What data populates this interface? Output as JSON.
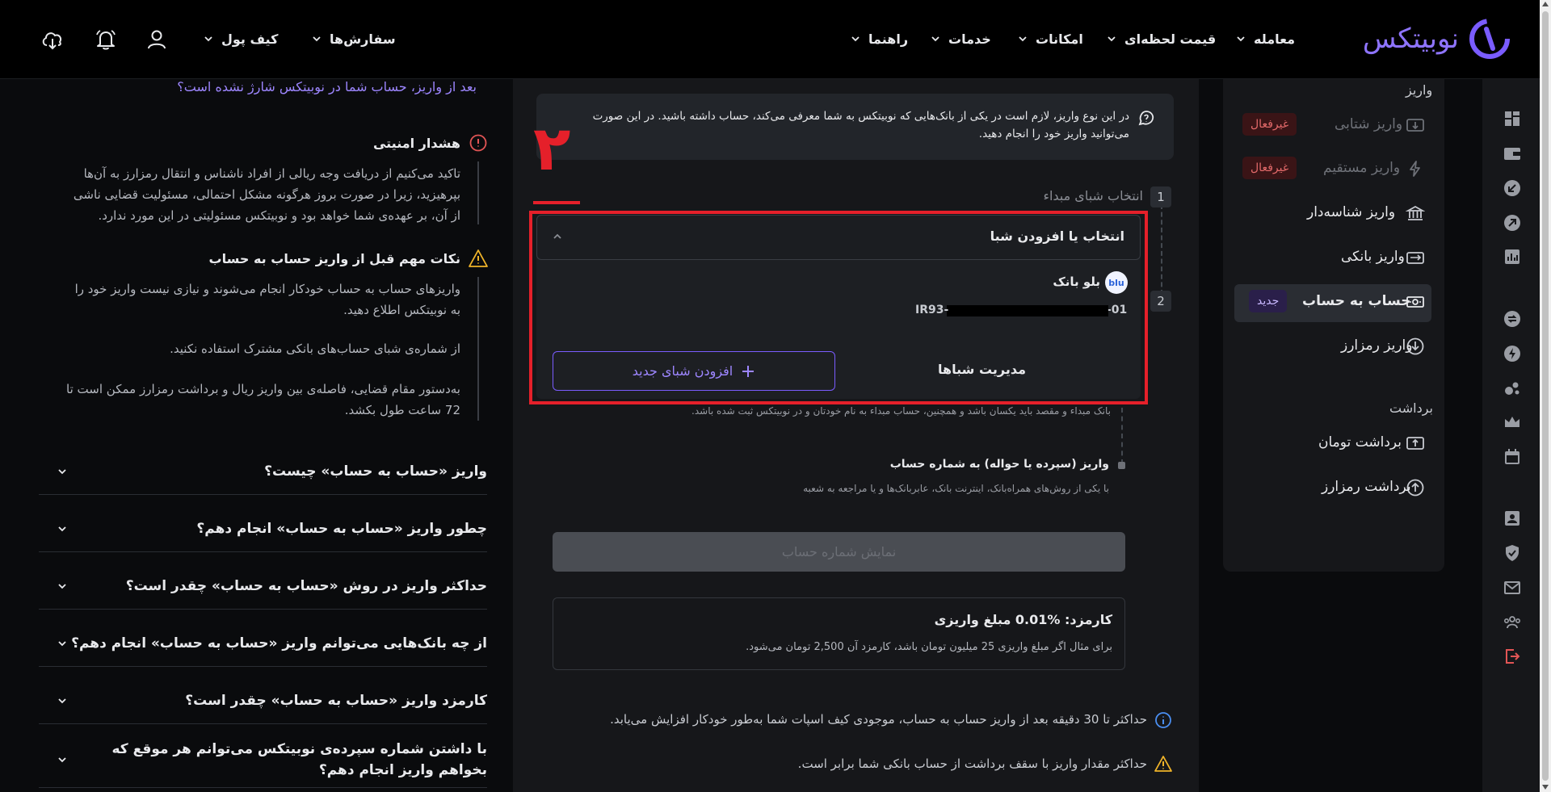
{
  "header": {
    "logo_text": "نوبیتکس",
    "nav": [
      {
        "label": "معامله"
      },
      {
        "label": "قیمت لحظه‌ای"
      },
      {
        "label": "امکانات"
      },
      {
        "label": "خدمات"
      },
      {
        "label": "راهنما"
      },
      {
        "label": "سفارش‌ها"
      },
      {
        "label": "کیف پول"
      }
    ]
  },
  "sidebar": {
    "deposit_heading": "واریز",
    "withdraw_heading": "برداشت",
    "items": [
      {
        "label": "واریز شتابی",
        "badge": "غیرفعال"
      },
      {
        "label": "واریز مستقیم",
        "badge": "غیرفعال"
      },
      {
        "label": "واریز شناسه‌دار"
      },
      {
        "label": "واریز بانکی"
      },
      {
        "label": "حساب به حساب",
        "badge": "جدید"
      },
      {
        "label": "واریز رمزارز"
      },
      {
        "label": "برداشت تومان"
      },
      {
        "label": "برداشت رمزارز"
      }
    ]
  },
  "main": {
    "info_line1": "در این نوع واریز، لازم است در یکی از بانک‌هایی که نوبیتکس به شما معرفی می‌کند، حساب داشته باشید. در این صورت",
    "info_line2": "می‌توانید واریز خود را انجام دهید.",
    "annotation_number": "۲",
    "step1_num": "1",
    "step1_label": "انتخاب شبای مبداء",
    "step2_num": "2",
    "select_placeholder": "انتخاب یا افزودن شبا",
    "bank_name": "بلو بانک",
    "bank_logo": "blu",
    "iban_prefix": "IR93-",
    "iban_suffix": "-01",
    "manage_label": "مدیریت شباها",
    "add_iban_label": "افزودن شبای جدید",
    "note_same_bank": "بانک مبداء و مقصد باید یکسان باشد و همچنین، حساب مبداء به نام خودتان و در نوبیتکس ثبت شده باشد.",
    "deposit_method_title": "واریز (سپرده یا حواله) به شماره حساب",
    "deposit_method_desc": "با یکی از روش‌های همراه‌بانک، اینترنت بانک، عابربانک‌ها و یا مراجعه به شعبه",
    "show_account_label": "نمایش شماره حساب",
    "fee_title": "کارمزد: %0.01 مبلغ واریزی",
    "fee_desc": "برای مثال اگر مبلغ واریزی 25 میلیون تومان باشد، کارمزد آن 2,500 تومان می‌شود.",
    "footer_note1": "حداکثر تا 30 دقیقه بعد از واریز حساب به حساب، موجودی کیف اسپات شما به‌طور خودکار افزایش می‌یابد.",
    "footer_note2": "حداکثر مقدار واریز با سقف برداشت از حساب بانکی شما برابر است."
  },
  "help": {
    "top_link": "بعد از واریز، حساب شما در نوبیتکس شارژ نشده است؟",
    "security_title": "هشدار امنیتی",
    "security_line1": "تاکید می‌کنیم از دریافت وجه ریالی از افراد ناشناس و انتقال رمزارز به آن‌ها",
    "security_line2": "بپرهیزید، زیرا در صورت بروز هرگونه مشکل احتمالی، مسئولیت قضایی ناشی",
    "security_line3": "از آن، بر عهده‌ی شما خواهد بود و نوبیتکس مسئولیتی در این مورد ندارد.",
    "tips_title": "نکات مهم قبل از واریز حساب به حساب",
    "tip1_line1": "واریزهای حساب به حساب خودکار انجام می‌شوند و نیازی نیست واریز خود را",
    "tip1_line2": "به نوبیتکس اطلاع دهید.",
    "tip2": "از شماره‌ی شبای حساب‌های بانکی مشترک استفاده نکنید.",
    "tip3_line1": "به‌دستور مقام قضایی، فاصله‌ی بین واریز ریال و برداشت رمزارز ممکن است تا",
    "tip3_line2": "72 ساعت طول بکشد.",
    "faq": [
      {
        "q": "واریز «حساب به حساب» چیست؟"
      },
      {
        "q": "چطور واریز «حساب به حساب» انجام دهم؟"
      },
      {
        "q": "حداکثر واریز در روش «حساب به حساب» چقدر است؟"
      },
      {
        "q": "از چه بانک‌هایی می‌توانم واریز «حساب به حساب» انجام دهم؟"
      },
      {
        "q": "کارمزد واریز «حساب به حساب» چقدر است؟"
      },
      {
        "q": "با داشتن شماره سپرده‌ی نوبیتکس می‌توانم هر موقع که"
      },
      {
        "q": "بخواهم واریز انجام دهم؟"
      }
    ]
  },
  "colors": {
    "accent": "#7a5cff",
    "annotation_red": "#e5202a",
    "badge_red_text": "#e46a6a",
    "badge_purple_bg": "#2a1f4a"
  }
}
